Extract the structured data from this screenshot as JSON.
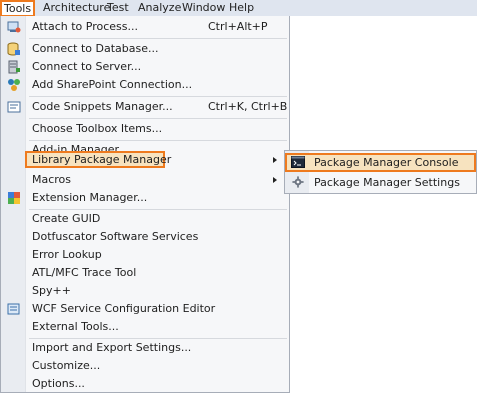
{
  "menubar": {
    "items": [
      "Tools",
      "Architecture",
      "Test",
      "Analyze",
      "Window",
      "Help"
    ],
    "active": "Tools"
  },
  "tools_menu": {
    "items": [
      {
        "label": "Attach to Process...",
        "shortcut": "Ctrl+Alt+P",
        "icon": "attach-process-icon"
      },
      {
        "label": "Connect to Database...",
        "icon": "database-icon"
      },
      {
        "label": "Connect to Server...",
        "icon": "server-icon"
      },
      {
        "label": "Add SharePoint Connection...",
        "icon": "sharepoint-icon"
      },
      {
        "label": "Code Snippets Manager...",
        "shortcut": "Ctrl+K, Ctrl+B",
        "icon": "snippets-icon"
      },
      {
        "label": "Choose Toolbox Items..."
      },
      {
        "label": "Add-in Manager..."
      },
      {
        "label": "Library Package Manager",
        "submenu": true
      },
      {
        "label": "Macros",
        "submenu": true
      },
      {
        "label": "Extension Manager...",
        "icon": "extension-icon"
      },
      {
        "label": "Create GUID"
      },
      {
        "label": "Dotfuscator Software Services"
      },
      {
        "label": "Error Lookup"
      },
      {
        "label": "ATL/MFC Trace Tool"
      },
      {
        "label": "Spy++"
      },
      {
        "label": "WCF Service Configuration Editor",
        "icon": "wcf-icon"
      },
      {
        "label": "External Tools..."
      },
      {
        "label": "Import and Export Settings..."
      },
      {
        "label": "Customize..."
      },
      {
        "label": "Options..."
      }
    ]
  },
  "submenu": {
    "items": [
      {
        "label": "Package Manager Console",
        "icon": "console-icon"
      },
      {
        "label": "Package Manager Settings",
        "icon": "gear-icon"
      }
    ]
  },
  "colors": {
    "highlight_border": "#ee7a1e",
    "highlight_fill": "#f7e3bf",
    "menu_bg": "#f6f7f9",
    "menubar_bg": "#dfe5ef"
  }
}
